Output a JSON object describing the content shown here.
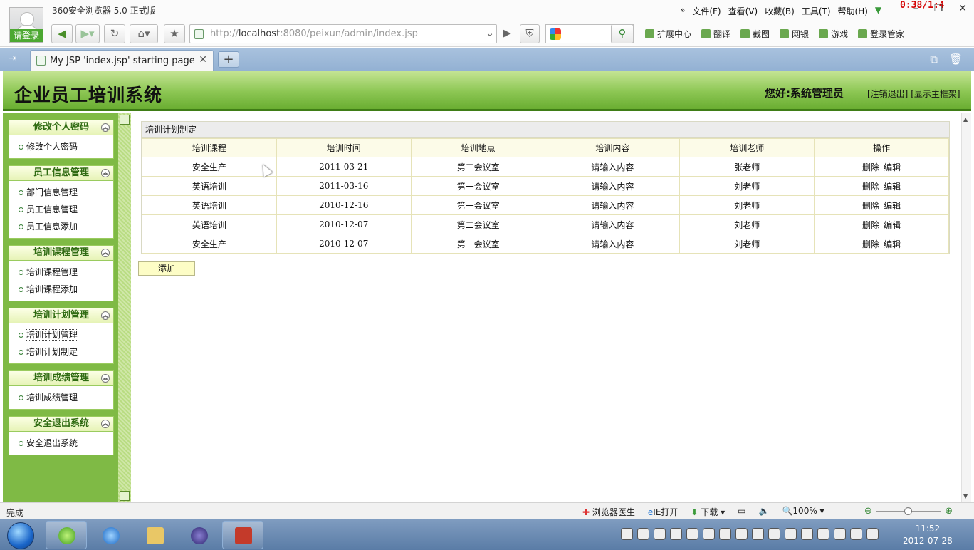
{
  "browser": {
    "title": "360安全浏览器 5.0 正式版",
    "login_label": "请登录",
    "timer": "0:38/1:4",
    "menu": [
      "文件(F)",
      "查看(V)",
      "收藏(B)",
      "工具(T)",
      "帮助(H)"
    ],
    "address_prefix": "http://",
    "address_host": "localhost",
    "address_rest": ":8080/peixun/admin/index.jsp",
    "tool_items": [
      "扩展中心",
      "翻译",
      "截图",
      "网银",
      "游戏",
      "登录管家"
    ],
    "tab_title": "My JSP 'index.jsp' starting page"
  },
  "app": {
    "title": "企业员工培训系统",
    "greeting": "您好:系统管理员",
    "logout_link": "[注销退出]",
    "frame_link": "[显示主框架]"
  },
  "sidebar": {
    "groups": [
      {
        "title": "修改个人密码",
        "items": [
          "修改个人密码"
        ]
      },
      {
        "title": "员工信息管理",
        "items": [
          "部门信息管理",
          "员工信息管理",
          "员工信息添加"
        ]
      },
      {
        "title": "培训课程管理",
        "items": [
          "培训课程管理",
          "培训课程添加"
        ]
      },
      {
        "title": "培训计划管理",
        "items": [
          "培训计划管理",
          "培训计划制定"
        ]
      },
      {
        "title": "培训成绩管理",
        "items": [
          "培训成绩管理"
        ]
      },
      {
        "title": "安全退出系统",
        "items": [
          "安全退出系统"
        ]
      }
    ]
  },
  "main": {
    "panel_title": "培训计划制定",
    "columns": [
      "培训课程",
      "培训时间",
      "培训地点",
      "培训内容",
      "培训老师",
      "操作"
    ],
    "rows": [
      {
        "course": "安全生产",
        "date": "2011-03-21",
        "place": "第二会议室",
        "content": "请输入内容",
        "teacher": "张老师",
        "delete": "删除",
        "edit": "编辑"
      },
      {
        "course": "英语培训",
        "date": "2011-03-16",
        "place": "第一会议室",
        "content": "请输入内容",
        "teacher": "刘老师",
        "delete": "删除",
        "edit": "编辑"
      },
      {
        "course": "英语培训",
        "date": "2010-12-16",
        "place": "第一会议室",
        "content": "请输入内容",
        "teacher": "刘老师",
        "delete": "删除",
        "edit": "编辑"
      },
      {
        "course": "英语培训",
        "date": "2010-12-07",
        "place": "第二会议室",
        "content": "请输入内容",
        "teacher": "刘老师",
        "delete": "删除",
        "edit": "编辑"
      },
      {
        "course": "安全生产",
        "date": "2010-12-07",
        "place": "第一会议室",
        "content": "请输入内容",
        "teacher": "刘老师",
        "delete": "删除",
        "edit": "编辑"
      }
    ],
    "add_label": "添加"
  },
  "status": {
    "text": "完成",
    "items": [
      "浏览器医生",
      "IE打开",
      "下载",
      "100%"
    ]
  },
  "taskbar": {
    "time": "11:52",
    "date": "2012-07-28"
  },
  "colors": {
    "header_green": "#8cc653",
    "sidebar_green": "#7fba45",
    "group_title": "#2f6b12"
  }
}
